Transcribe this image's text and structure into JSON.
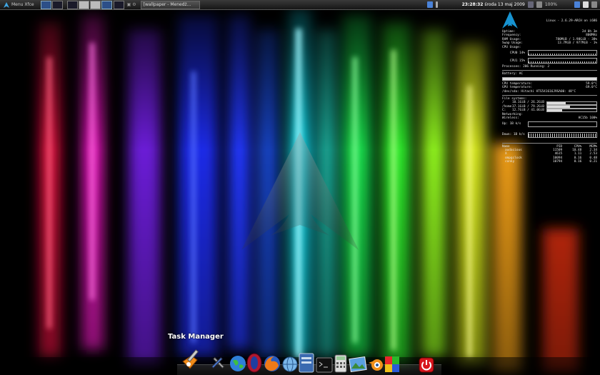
{
  "top_panel": {
    "menu_label": "Menu Xfce",
    "task_label": "[wallpaper - Menedż...",
    "clock_time": "23:28:32",
    "clock_date": "środa 13 maj 2009",
    "battery": "100%"
  },
  "conky": {
    "system": "Linux - 2.6.29-ARCH on i686",
    "uptime": {
      "label": "Uptime:",
      "value": "2d 0h 3m"
    },
    "frequency": {
      "label": "Frequency:",
      "value": "800MHz"
    },
    "ram": {
      "label": "RAM Usage:",
      "value": "780MiB / 1.98GiB - 38%",
      "percent": 38
    },
    "swap": {
      "label": "Swap Usage:",
      "value": "13.7MiB / 977MiB - 1%",
      "percent": 1
    },
    "cpu_label": "CPU Usage:",
    "cpu1": {
      "label": "CPU0 14%",
      "percent": 14
    },
    "cpu2": {
      "label": "CPU1 15%",
      "percent": 15
    },
    "processes": "Processes: 206  Running: 2",
    "battery": "Battery: AC",
    "cpu_temp1": {
      "label": "CPU temperature:",
      "value": "59.0°C"
    },
    "cpu_temp2": {
      "label": "GPU temperature:",
      "value": "69.0°C"
    },
    "disk_temp": "/dev/sda: Hitachi HTS541616J9SA00: 48°C",
    "fs_label": "File systems:",
    "fs": [
      {
        "mount": "/",
        "usage": "10.1GiB / 26.2GiB",
        "percent": 38
      },
      {
        "mount": "/home",
        "usage": "37.1GiB / 79.2GiB",
        "percent": 47
      },
      {
        "mount": "C:",
        "usage": "12.7GiB / 41.0GiB",
        "percent": 31
      }
    ],
    "net_label": "Networking:",
    "wireless": {
      "label": "Wireless:",
      "value": "HC15b 100%"
    },
    "up": "Up: 1B  k/s",
    "down": "Down: 1B  k/s",
    "proc_headers": [
      "Name",
      "PID",
      "CPU%",
      "MEM%"
    ],
    "procs": [
      [
        "audacious",
        "11509",
        "10.48",
        "2.34"
      ],
      [
        "X",
        "4615",
        "1.11",
        "2.53"
      ],
      [
        "ompgclock",
        "10094",
        "0.16",
        "0.48"
      ],
      [
        "conky",
        "10794",
        "0.16",
        "0.21"
      ]
    ]
  },
  "dock": {
    "tooltip": "Task Manager"
  }
}
